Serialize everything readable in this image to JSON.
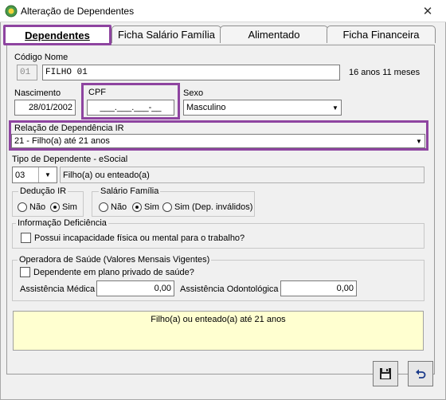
{
  "window": {
    "title": "Alteração de Dependentes",
    "close_icon": "close-icon"
  },
  "tabs": [
    {
      "label": "Dependentes"
    },
    {
      "label": "Ficha Salário Família"
    },
    {
      "label": "Alimentado"
    },
    {
      "label": "Ficha Financeira"
    }
  ],
  "codigo_nome": {
    "label": "Código Nome",
    "code_value": "01",
    "name_value": "FILHO 01",
    "age_text": "16 anos 11 meses"
  },
  "nascimento": {
    "label": "Nascimento",
    "value": "28/01/2002"
  },
  "cpf": {
    "label": "CPF",
    "mask": "___.___.___-__"
  },
  "sexo": {
    "label": "Sexo",
    "value": "Masculino"
  },
  "relacao": {
    "label": "Relação de Dependência IR",
    "value": "21 - Filho(a) até 21 anos"
  },
  "tipo_dependente": {
    "label": "Tipo de Dependente - eSocial",
    "code": "03",
    "description": "Filho(a) ou enteado(a)"
  },
  "deducao_ir": {
    "label": "Dedução IR",
    "options": [
      "Não",
      "Sim"
    ],
    "selected": "Sim"
  },
  "salario_familia": {
    "label": "Salário Família",
    "options": [
      "Não",
      "Sim",
      "Sim (Dep. inválidos)"
    ],
    "selected": "Sim"
  },
  "deficiencia": {
    "label": "Informação Deficiência",
    "checkbox_label": "Possui incapacidade física ou mental para o trabalho?"
  },
  "operadora": {
    "label": "Operadora de Saúde (Valores Mensais Vigentes)",
    "checkbox_label": "Dependente em plano privado de saúde?",
    "medica_label": "Assistência Médica",
    "medica_value": "0,00",
    "odonto_label": "Assistência Odontológica",
    "odonto_value": "0,00"
  },
  "info_text": "Filho(a) ou enteado(a) até 21 anos",
  "accent_color": "#8e44a0"
}
